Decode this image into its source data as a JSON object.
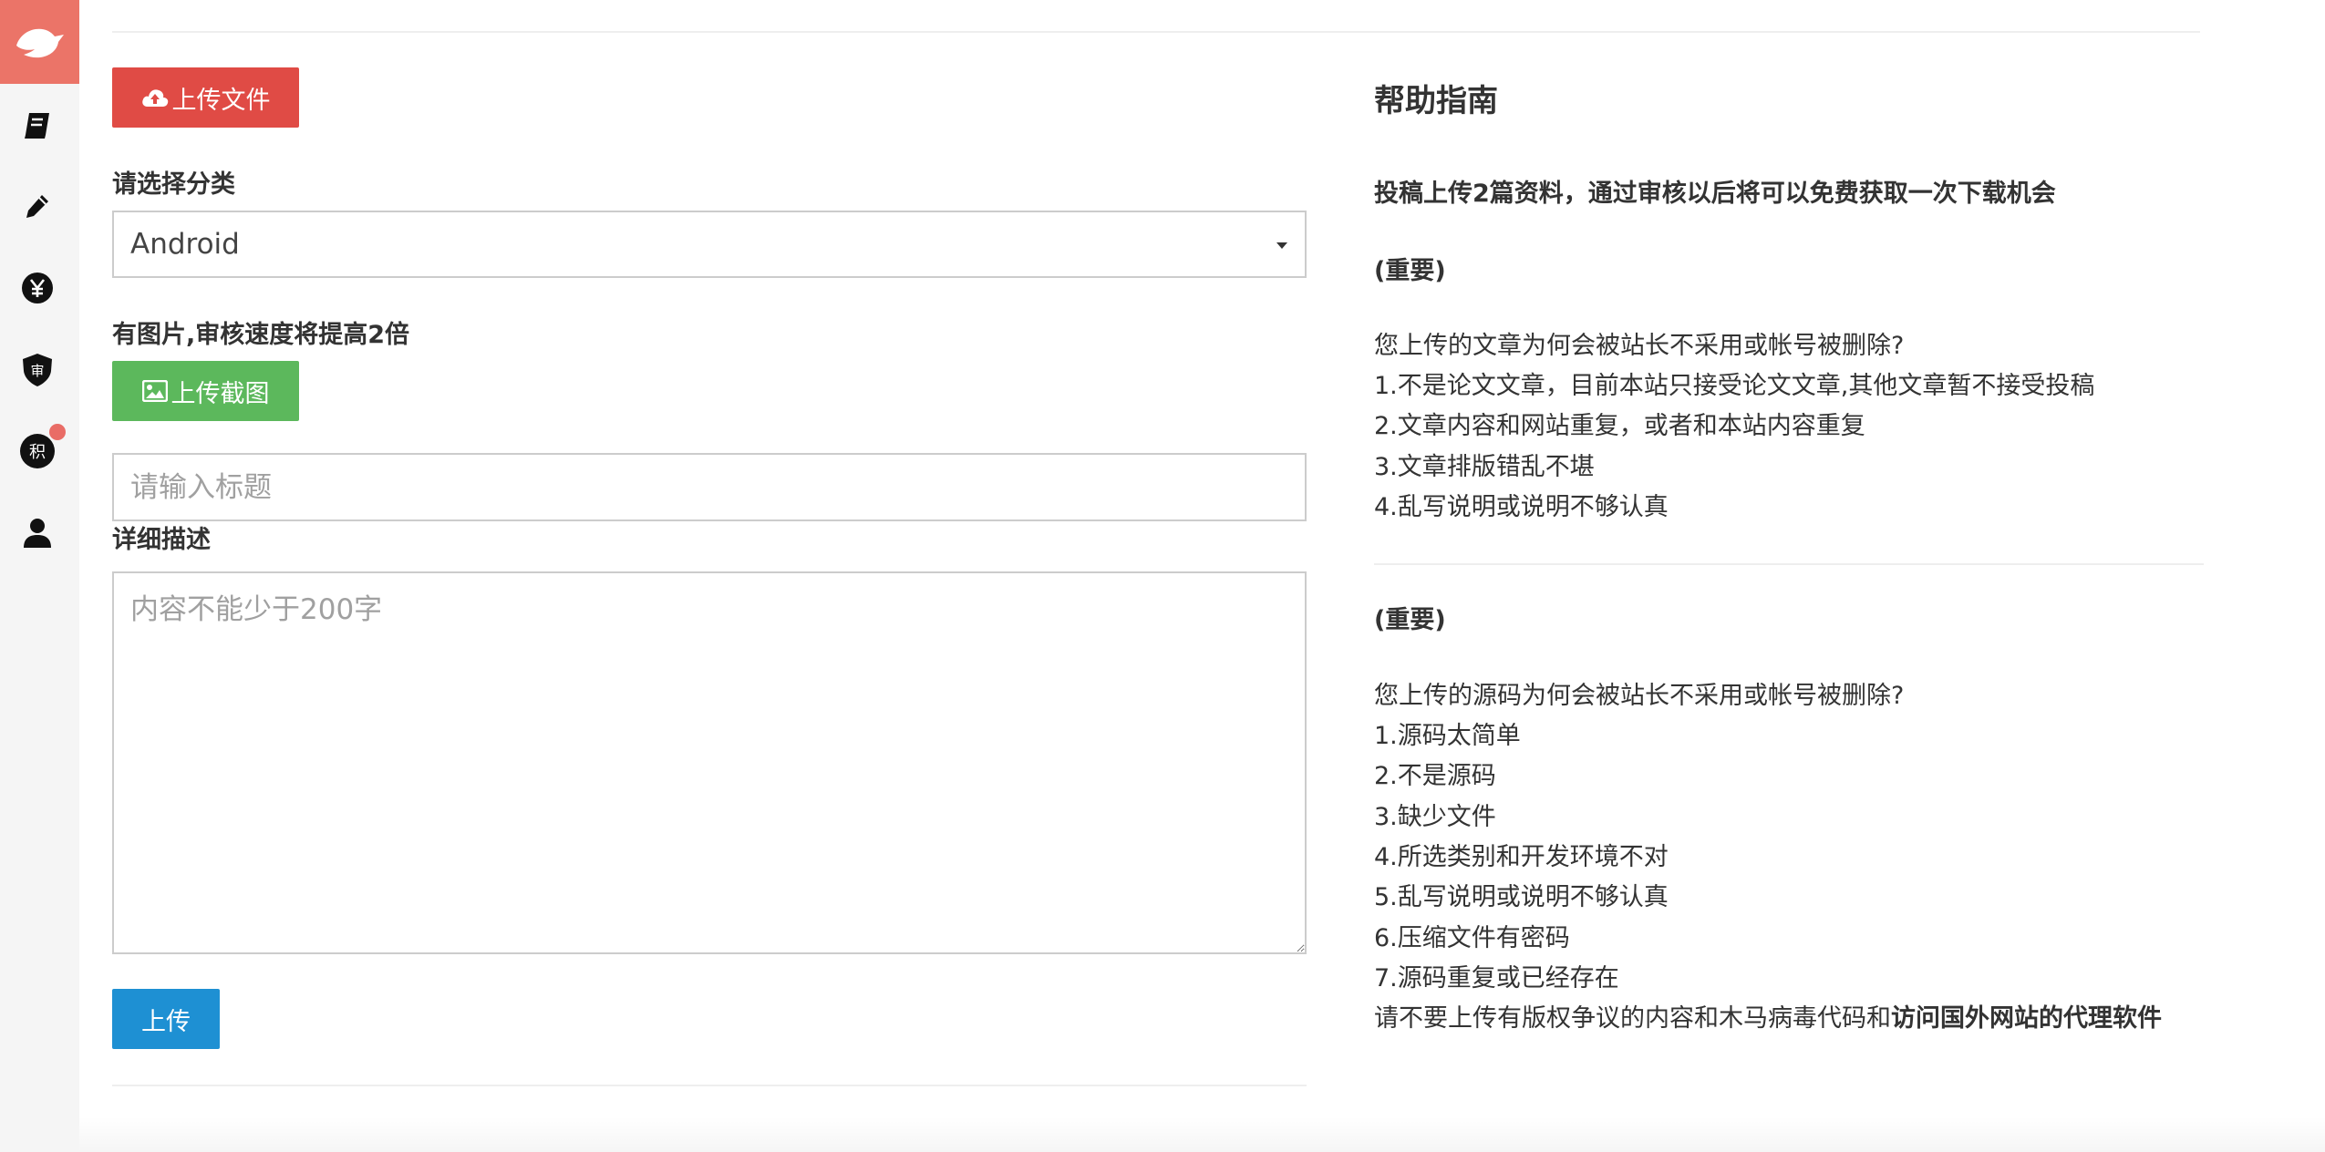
{
  "sidebar": {
    "items": [
      {
        "name": "book"
      },
      {
        "name": "pencil"
      },
      {
        "name": "yen"
      },
      {
        "name": "shield",
        "label": "审"
      },
      {
        "name": "points",
        "label": "积"
      },
      {
        "name": "user"
      }
    ],
    "badge_color": "#e96c66"
  },
  "form": {
    "upload_file_label": "上传文件",
    "category_label": "请选择分类",
    "category_selected": "Android",
    "image_hint": "有图片,审核速度将提高2倍",
    "upload_screenshot_label": "上传截图",
    "title_placeholder": "请输入标题",
    "description_label": "详细描述",
    "description_placeholder": "内容不能少于200字",
    "submit_label": "上传"
  },
  "help": {
    "title": "帮助指南",
    "intro": "投稿上传2篇资料，通过审核以后将可以免费获取一次下载机会",
    "section1": {
      "important": "(重要)",
      "question": "您上传的文章为何会被站长不采用或帐号被删除?",
      "items": [
        "1.不是论文文章，目前本站只接受论文文章,其他文章暂不接受投稿",
        "2.文章内容和网站重复，或者和本站内容重复",
        "3.文章排版错乱不堪",
        "4.乱写说明或说明不够认真"
      ]
    },
    "section2": {
      "important": "(重要)",
      "question": "您上传的源码为何会被站长不采用或帐号被删除?",
      "items": [
        "1.源码太简单",
        "2.不是源码",
        "3.缺少文件",
        "4.所选类别和开发环境不对",
        "5.乱写说明或说明不够认真",
        "6.压缩文件有密码",
        "7.源码重复或已经存在"
      ],
      "warning_prefix": "请不要上传有版权争议的内容和木马病毒代码和",
      "warning_bold": "访问国外网站的代理软件"
    }
  },
  "colors": {
    "logo_bg": "#eb7468",
    "upload_file": "#e04b45",
    "upload_screenshot": "#5cb85c",
    "submit": "#1e90d3"
  }
}
